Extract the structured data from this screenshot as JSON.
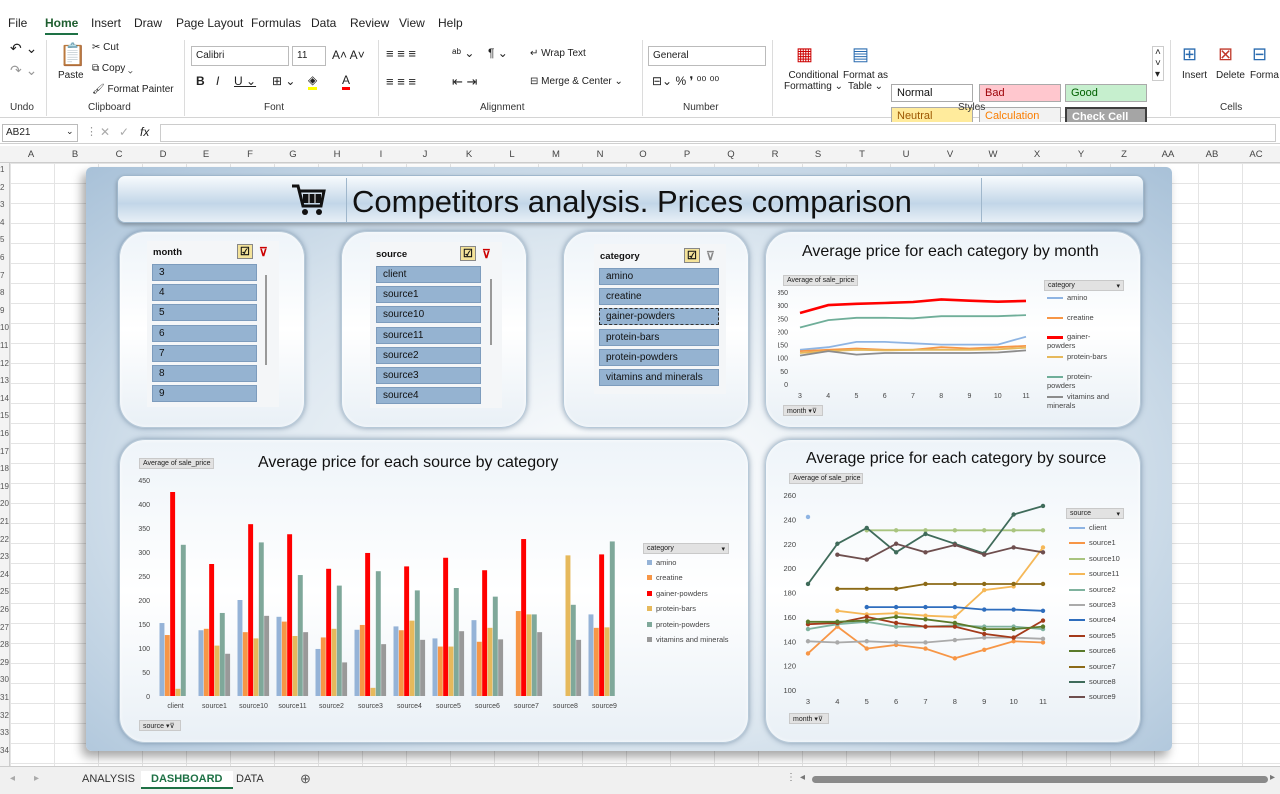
{
  "ribbon_tabs": [
    "File",
    "Home",
    "Insert",
    "Draw",
    "Page Layout",
    "Formulas",
    "Data",
    "Review",
    "View",
    "Help"
  ],
  "active_tab": "Home",
  "ribbon": {
    "undo_label": "Undo",
    "clipboard": {
      "paste": "Paste",
      "cut": "Cut",
      "copy": "Copy",
      "format_painter": "Format Painter",
      "label": "Clipboard"
    },
    "font": {
      "name": "Calibri",
      "size": "11",
      "label": "Font"
    },
    "alignment": {
      "wrap_text": "Wrap Text",
      "merge_center": "Merge & Center",
      "label": "Alignment"
    },
    "number": {
      "format": "General",
      "label": "Number"
    },
    "styles": {
      "conditional": "Conditional",
      "formatting": "Formatting",
      "format_as": "Format as",
      "table": "Table",
      "label": "Styles",
      "cells": [
        {
          "text": "Normal",
          "bg": "#ffffff",
          "fg": "#111111"
        },
        {
          "text": "Bad",
          "bg": "#ffc7ce",
          "fg": "#9c0006"
        },
        {
          "text": "Good",
          "bg": "#c6efce",
          "fg": "#006100"
        },
        {
          "text": "Neutral",
          "bg": "#ffeb9c",
          "fg": "#9c5700"
        },
        {
          "text": "Calculation",
          "bg": "#f2f2f2",
          "fg": "#fa7d00"
        },
        {
          "text": "Check Cell",
          "bg": "#a5a5a5",
          "fg": "#ffffff"
        }
      ]
    },
    "cells": {
      "insert": "Insert",
      "delete": "Delete",
      "format": "Forma",
      "label": "Cells"
    }
  },
  "name_box": "AB21",
  "fx": "fx",
  "columns": [
    "A",
    "B",
    "C",
    "D",
    "E",
    "F",
    "G",
    "H",
    "I",
    "J",
    "K",
    "L",
    "M",
    "N",
    "O",
    "P",
    "Q",
    "R",
    "S",
    "T",
    "U",
    "V",
    "W",
    "X",
    "Y",
    "Z",
    "AA",
    "AB",
    "AC"
  ],
  "rows": [
    "1",
    "2",
    "3",
    "4",
    "5",
    "6",
    "7",
    "8",
    "9",
    "10",
    "11",
    "12",
    "13",
    "14",
    "15",
    "16",
    "17",
    "18",
    "19",
    "20",
    "21",
    "22",
    "23",
    "24",
    "25",
    "26",
    "27",
    "28",
    "29",
    "30",
    "31",
    "32",
    "33",
    "34"
  ],
  "dashboard": {
    "title": "Competitors analysis. Prices comparison",
    "slicers": [
      {
        "title": "month",
        "items": [
          "3",
          "4",
          "5",
          "6",
          "7",
          "8",
          "9"
        ]
      },
      {
        "title": "source",
        "items": [
          "client",
          "source1",
          "source10",
          "source11",
          "source2",
          "source3",
          "source4"
        ]
      },
      {
        "title": "category",
        "items": [
          "amino",
          "creatine",
          "gainer-powders",
          "protein-bars",
          "protein-powders",
          "vitamins and minerals"
        ]
      }
    ]
  },
  "chart_data": [
    {
      "type": "line",
      "title": "Average price for each category by month",
      "value_field": "Average of sale_price",
      "legend_field": "category",
      "axis_field": "month",
      "x": [
        3,
        4,
        5,
        6,
        7,
        8,
        9,
        10,
        11
      ],
      "ylim": [
        0,
        350
      ],
      "yticks": [
        0,
        50,
        100,
        150,
        200,
        250,
        300,
        350
      ],
      "series": [
        {
          "name": "amino",
          "color": "#8eb4e3",
          "values": [
            130,
            140,
            160,
            160,
            155,
            150,
            150,
            150,
            180
          ]
        },
        {
          "name": "creatine",
          "color": "#f79646",
          "values": [
            125,
            130,
            135,
            130,
            130,
            140,
            135,
            140,
            145
          ]
        },
        {
          "name": "gainer-powders",
          "color": "#ff0000",
          "values": [
            270,
            300,
            305,
            308,
            312,
            322,
            317,
            313,
            316
          ]
        },
        {
          "name": "protein-bars",
          "color": "#e6b95c",
          "values": [
            118,
            125,
            130,
            128,
            130,
            130,
            130,
            132,
            138
          ]
        },
        {
          "name": "protein-powders",
          "color": "#6fae99",
          "values": [
            215,
            243,
            252,
            252,
            250,
            258,
            258,
            258,
            262
          ]
        },
        {
          "name": "vitamins and minerals",
          "color": "#8c8c8c",
          "values": [
            108,
            125,
            112,
            118,
            118,
            118,
            118,
            120,
            128
          ]
        }
      ]
    },
    {
      "type": "bar",
      "title": "Average price for each source by category",
      "value_field": "Average of sale_price",
      "legend_field": "category",
      "axis_field": "source",
      "categories": [
        "client",
        "source1",
        "source10",
        "source11",
        "source2",
        "source3",
        "source4",
        "source5",
        "source6",
        "source7",
        "source8",
        "source9"
      ],
      "ylim": [
        0,
        450
      ],
      "yticks": [
        0,
        50,
        100,
        150,
        200,
        250,
        300,
        350,
        400,
        450
      ],
      "series": [
        {
          "name": "amino",
          "color": "#95b3d7",
          "values": [
            152,
            137,
            200,
            165,
            98,
            138,
            145,
            120,
            158,
            0,
            0,
            170
          ]
        },
        {
          "name": "creatine",
          "color": "#f79646",
          "values": [
            127,
            140,
            133,
            155,
            122,
            148,
            137,
            103,
            113,
            177,
            0,
            142
          ]
        },
        {
          "name": "gainer-powders",
          "color": "#ff0000",
          "values": [
            425,
            275,
            358,
            337,
            265,
            298,
            270,
            288,
            262,
            327,
            0,
            295
          ]
        },
        {
          "name": "protein-bars",
          "color": "#e6b95c",
          "values": [
            15,
            105,
            120,
            125,
            140,
            17,
            157,
            103,
            142,
            170,
            293,
            143
          ]
        },
        {
          "name": "protein-powders",
          "color": "#7fa89a",
          "values": [
            315,
            173,
            320,
            252,
            230,
            260,
            220,
            225,
            207,
            170,
            190,
            322
          ]
        },
        {
          "name": "vitamins and minerals",
          "color": "#999999",
          "values": [
            0,
            88,
            167,
            133,
            70,
            108,
            117,
            135,
            118,
            133,
            117,
            0
          ]
        }
      ]
    },
    {
      "type": "line",
      "title": "Average price for each category by source",
      "value_field": "Average of sale_price",
      "legend_field": "source",
      "axis_field": "month",
      "x": [
        3,
        4,
        5,
        6,
        7,
        8,
        9,
        10,
        11
      ],
      "ylim": [
        100,
        260
      ],
      "yticks": [
        100,
        120,
        140,
        160,
        180,
        200,
        220,
        240,
        260
      ],
      "series": [
        {
          "name": "client",
          "color": "#8eb4e3",
          "values": [
            242,
            null,
            null,
            null,
            null,
            null,
            null,
            null,
            null
          ]
        },
        {
          "name": "source1",
          "color": "#f79646",
          "values": [
            130,
            152,
            134,
            137,
            134,
            126,
            133,
            140,
            139
          ]
        },
        {
          "name": "source10",
          "color": "#a9c47f",
          "values": [
            null,
            null,
            231,
            231,
            231,
            231,
            231,
            231,
            231
          ]
        },
        {
          "name": "source11",
          "color": "#f5b858",
          "values": [
            null,
            165,
            162,
            163,
            161,
            160,
            182,
            185,
            217
          ]
        },
        {
          "name": "source2",
          "color": "#7fb29e",
          "values": [
            150,
            154,
            156,
            152,
            152,
            153,
            152,
            152,
            150
          ]
        },
        {
          "name": "source3",
          "color": "#aaaaaa",
          "values": [
            140,
            139,
            140,
            139,
            139,
            141,
            143,
            143,
            142
          ]
        },
        {
          "name": "source4",
          "color": "#2e6dbd",
          "values": [
            null,
            null,
            168,
            168,
            168,
            168,
            166,
            166,
            165
          ]
        },
        {
          "name": "source5",
          "color": "#a43a1a",
          "values": [
            154,
            155,
            160,
            155,
            152,
            152,
            146,
            143,
            157
          ]
        },
        {
          "name": "source6",
          "color": "#5a7a2a",
          "values": [
            156,
            156,
            157,
            160,
            158,
            155,
            150,
            150,
            152
          ]
        },
        {
          "name": "source7",
          "color": "#8c6a17",
          "values": [
            null,
            183,
            183,
            183,
            187,
            187,
            187,
            187,
            187
          ]
        },
        {
          "name": "source8",
          "color": "#3f6b5a",
          "values": [
            187,
            220,
            233,
            213,
            228,
            220,
            212,
            244,
            251
          ]
        },
        {
          "name": "source9",
          "color": "#6e4e4e",
          "values": [
            null,
            211,
            207,
            220,
            213,
            219,
            211,
            217,
            213
          ]
        }
      ]
    }
  ],
  "sheet_tabs": [
    "ANALYSIS",
    "DASHBOARD",
    "DATA"
  ],
  "active_sheet": "DASHBOARD"
}
